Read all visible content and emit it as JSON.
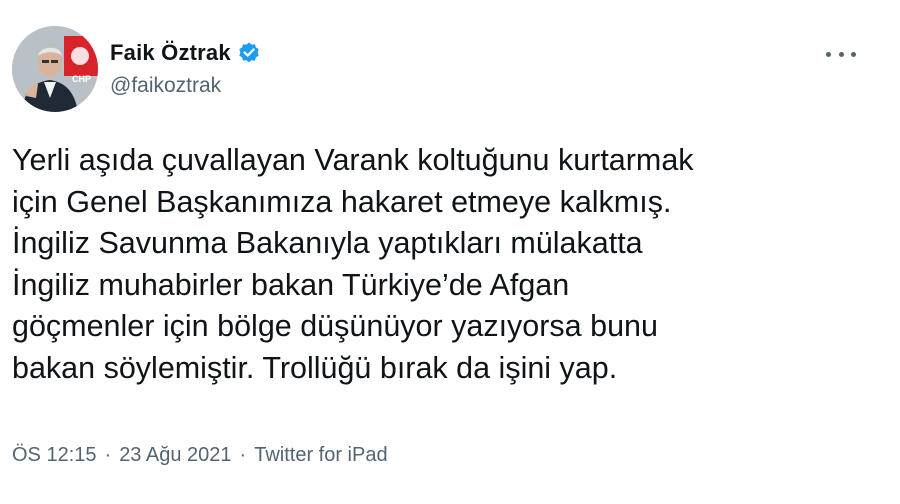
{
  "author": {
    "display_name": "Faik Öztrak",
    "handle": "@faikoztrak",
    "avatar_label": "CHP"
  },
  "tweet": {
    "lines": [
      "Yerli aşıda çuvallayan Varank koltuğunu kurtarmak",
      "için Genel Başkanımıza hakaret etmeye kalkmış.",
      "İngiliz Savunma Bakanıyla yaptıkları mülakatta",
      "İngiliz muhabirler bakan Türkiye’de Afgan",
      "göçmenler için bölge düşünüyor yazıyorsa bunu",
      "bakan söylemiştir. Trollüğü bırak da işini yap."
    ]
  },
  "meta": {
    "time": "ÖS 12:15",
    "separator": "·",
    "date": "23 Ağu 2021",
    "source": "Twitter for iPad"
  },
  "colors": {
    "text": "#0f1419",
    "secondary": "#536471",
    "verified": "#1d9bf0"
  },
  "icons": {
    "verified": "verified-badge-icon",
    "more": "more-options-icon"
  }
}
